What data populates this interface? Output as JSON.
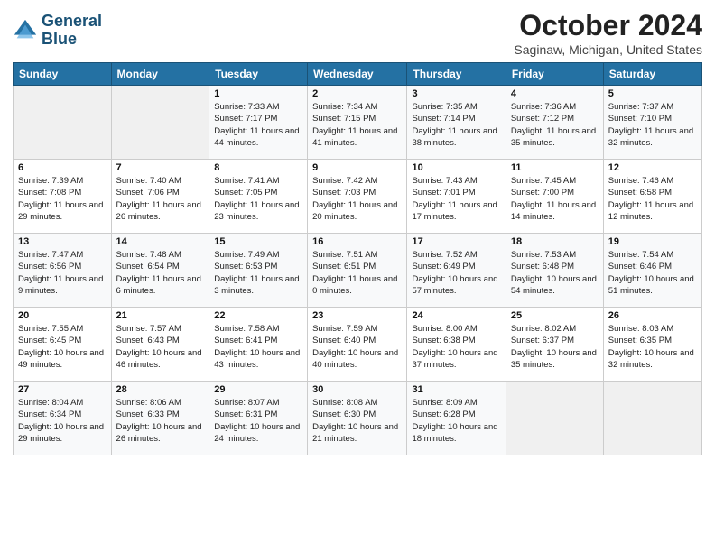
{
  "logo": {
    "line1": "General",
    "line2": "Blue"
  },
  "title": "October 2024",
  "subtitle": "Saginaw, Michigan, United States",
  "headers": [
    "Sunday",
    "Monday",
    "Tuesday",
    "Wednesday",
    "Thursday",
    "Friday",
    "Saturday"
  ],
  "weeks": [
    [
      {
        "day": "",
        "sunrise": "",
        "sunset": "",
        "daylight": ""
      },
      {
        "day": "",
        "sunrise": "",
        "sunset": "",
        "daylight": ""
      },
      {
        "day": "1",
        "sunrise": "Sunrise: 7:33 AM",
        "sunset": "Sunset: 7:17 PM",
        "daylight": "Daylight: 11 hours and 44 minutes."
      },
      {
        "day": "2",
        "sunrise": "Sunrise: 7:34 AM",
        "sunset": "Sunset: 7:15 PM",
        "daylight": "Daylight: 11 hours and 41 minutes."
      },
      {
        "day": "3",
        "sunrise": "Sunrise: 7:35 AM",
        "sunset": "Sunset: 7:14 PM",
        "daylight": "Daylight: 11 hours and 38 minutes."
      },
      {
        "day": "4",
        "sunrise": "Sunrise: 7:36 AM",
        "sunset": "Sunset: 7:12 PM",
        "daylight": "Daylight: 11 hours and 35 minutes."
      },
      {
        "day": "5",
        "sunrise": "Sunrise: 7:37 AM",
        "sunset": "Sunset: 7:10 PM",
        "daylight": "Daylight: 11 hours and 32 minutes."
      }
    ],
    [
      {
        "day": "6",
        "sunrise": "Sunrise: 7:39 AM",
        "sunset": "Sunset: 7:08 PM",
        "daylight": "Daylight: 11 hours and 29 minutes."
      },
      {
        "day": "7",
        "sunrise": "Sunrise: 7:40 AM",
        "sunset": "Sunset: 7:06 PM",
        "daylight": "Daylight: 11 hours and 26 minutes."
      },
      {
        "day": "8",
        "sunrise": "Sunrise: 7:41 AM",
        "sunset": "Sunset: 7:05 PM",
        "daylight": "Daylight: 11 hours and 23 minutes."
      },
      {
        "day": "9",
        "sunrise": "Sunrise: 7:42 AM",
        "sunset": "Sunset: 7:03 PM",
        "daylight": "Daylight: 11 hours and 20 minutes."
      },
      {
        "day": "10",
        "sunrise": "Sunrise: 7:43 AM",
        "sunset": "Sunset: 7:01 PM",
        "daylight": "Daylight: 11 hours and 17 minutes."
      },
      {
        "day": "11",
        "sunrise": "Sunrise: 7:45 AM",
        "sunset": "Sunset: 7:00 PM",
        "daylight": "Daylight: 11 hours and 14 minutes."
      },
      {
        "day": "12",
        "sunrise": "Sunrise: 7:46 AM",
        "sunset": "Sunset: 6:58 PM",
        "daylight": "Daylight: 11 hours and 12 minutes."
      }
    ],
    [
      {
        "day": "13",
        "sunrise": "Sunrise: 7:47 AM",
        "sunset": "Sunset: 6:56 PM",
        "daylight": "Daylight: 11 hours and 9 minutes."
      },
      {
        "day": "14",
        "sunrise": "Sunrise: 7:48 AM",
        "sunset": "Sunset: 6:54 PM",
        "daylight": "Daylight: 11 hours and 6 minutes."
      },
      {
        "day": "15",
        "sunrise": "Sunrise: 7:49 AM",
        "sunset": "Sunset: 6:53 PM",
        "daylight": "Daylight: 11 hours and 3 minutes."
      },
      {
        "day": "16",
        "sunrise": "Sunrise: 7:51 AM",
        "sunset": "Sunset: 6:51 PM",
        "daylight": "Daylight: 11 hours and 0 minutes."
      },
      {
        "day": "17",
        "sunrise": "Sunrise: 7:52 AM",
        "sunset": "Sunset: 6:49 PM",
        "daylight": "Daylight: 10 hours and 57 minutes."
      },
      {
        "day": "18",
        "sunrise": "Sunrise: 7:53 AM",
        "sunset": "Sunset: 6:48 PM",
        "daylight": "Daylight: 10 hours and 54 minutes."
      },
      {
        "day": "19",
        "sunrise": "Sunrise: 7:54 AM",
        "sunset": "Sunset: 6:46 PM",
        "daylight": "Daylight: 10 hours and 51 minutes."
      }
    ],
    [
      {
        "day": "20",
        "sunrise": "Sunrise: 7:55 AM",
        "sunset": "Sunset: 6:45 PM",
        "daylight": "Daylight: 10 hours and 49 minutes."
      },
      {
        "day": "21",
        "sunrise": "Sunrise: 7:57 AM",
        "sunset": "Sunset: 6:43 PM",
        "daylight": "Daylight: 10 hours and 46 minutes."
      },
      {
        "day": "22",
        "sunrise": "Sunrise: 7:58 AM",
        "sunset": "Sunset: 6:41 PM",
        "daylight": "Daylight: 10 hours and 43 minutes."
      },
      {
        "day": "23",
        "sunrise": "Sunrise: 7:59 AM",
        "sunset": "Sunset: 6:40 PM",
        "daylight": "Daylight: 10 hours and 40 minutes."
      },
      {
        "day": "24",
        "sunrise": "Sunrise: 8:00 AM",
        "sunset": "Sunset: 6:38 PM",
        "daylight": "Daylight: 10 hours and 37 minutes."
      },
      {
        "day": "25",
        "sunrise": "Sunrise: 8:02 AM",
        "sunset": "Sunset: 6:37 PM",
        "daylight": "Daylight: 10 hours and 35 minutes."
      },
      {
        "day": "26",
        "sunrise": "Sunrise: 8:03 AM",
        "sunset": "Sunset: 6:35 PM",
        "daylight": "Daylight: 10 hours and 32 minutes."
      }
    ],
    [
      {
        "day": "27",
        "sunrise": "Sunrise: 8:04 AM",
        "sunset": "Sunset: 6:34 PM",
        "daylight": "Daylight: 10 hours and 29 minutes."
      },
      {
        "day": "28",
        "sunrise": "Sunrise: 8:06 AM",
        "sunset": "Sunset: 6:33 PM",
        "daylight": "Daylight: 10 hours and 26 minutes."
      },
      {
        "day": "29",
        "sunrise": "Sunrise: 8:07 AM",
        "sunset": "Sunset: 6:31 PM",
        "daylight": "Daylight: 10 hours and 24 minutes."
      },
      {
        "day": "30",
        "sunrise": "Sunrise: 8:08 AM",
        "sunset": "Sunset: 6:30 PM",
        "daylight": "Daylight: 10 hours and 21 minutes."
      },
      {
        "day": "31",
        "sunrise": "Sunrise: 8:09 AM",
        "sunset": "Sunset: 6:28 PM",
        "daylight": "Daylight: 10 hours and 18 minutes."
      },
      {
        "day": "",
        "sunrise": "",
        "sunset": "",
        "daylight": ""
      },
      {
        "day": "",
        "sunrise": "",
        "sunset": "",
        "daylight": ""
      }
    ]
  ]
}
